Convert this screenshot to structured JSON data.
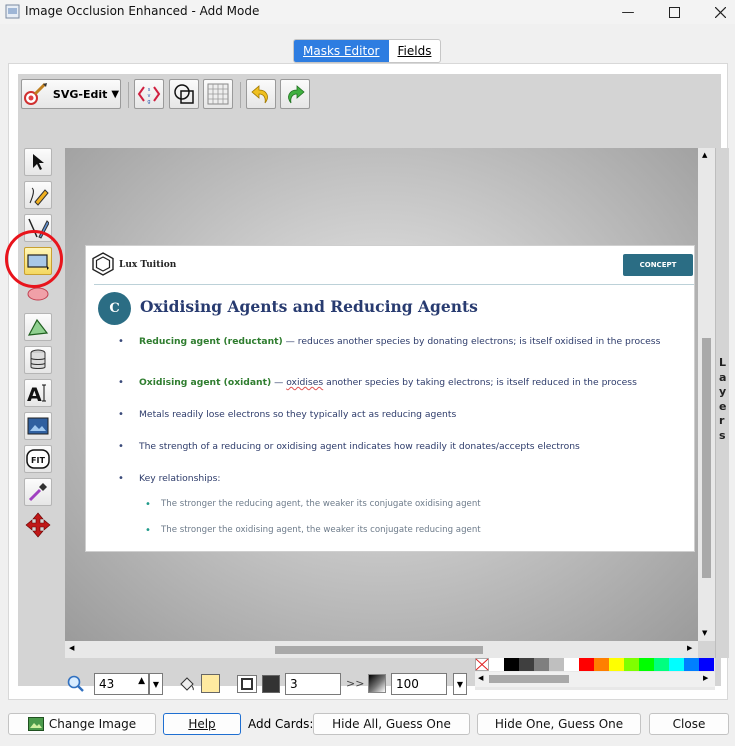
{
  "window": {
    "title": "Image Occlusion Enhanced - Add Mode"
  },
  "tabs": [
    {
      "label": "Masks Editor",
      "active": true
    },
    {
      "label": "Fields",
      "active": false
    }
  ],
  "toolbar": {
    "svgedit_label": "SVG-Edit"
  },
  "slide": {
    "brand": "Lux Tuition",
    "badge": "CONCEPT",
    "section_letter": "C",
    "title": "Oxidising Agents and Reducing Agents",
    "bullets": [
      {
        "term": "Reducing agent (reductant)",
        "text": " — reduces another species by donating electrons; is itself oxidised in the process"
      },
      {
        "term": "Oxidising agent (oxidant)",
        "text_pre": " — ",
        "underlined": "oxidises",
        "text_post": " another species by taking electrons; is itself reduced in the process"
      },
      {
        "text": "Metals readily lose electrons so they typically act as reducing agents"
      },
      {
        "text": "The strength of a reducing or oxidising agent indicates how readily it donates/accepts electrons"
      },
      {
        "text": "Key relationships:"
      }
    ],
    "sub_bullets": [
      "The stronger the reducing agent, the weaker its conjugate oxidising agent",
      "The stronger the oxidising agent, the weaker its conjugate reducing agent"
    ]
  },
  "side_panel": {
    "label": "Layers"
  },
  "bottom_controls": {
    "zoom": "43",
    "stroke_width": "3",
    "opacity": "100",
    "fill_color": "#ffeaa0",
    "stroke_color": "#333333"
  },
  "palette": [
    "#ffffff",
    "#000000",
    "#3f3f3f",
    "#7f7f7f",
    "#bfbfbf",
    "#ffffff",
    "#ff0000",
    "#ff7f00",
    "#ffff00",
    "#7fff00",
    "#00ff00",
    "#00ff7f",
    "#00ffff",
    "#007fff",
    "#0000ff"
  ],
  "buttons": {
    "change_image": "Change Image",
    "help": "Help",
    "add_cards_label": "Add Cards:",
    "hide_all": "Hide All, Guess One",
    "hide_one": "Hide One, Guess One",
    "close": "Close"
  }
}
